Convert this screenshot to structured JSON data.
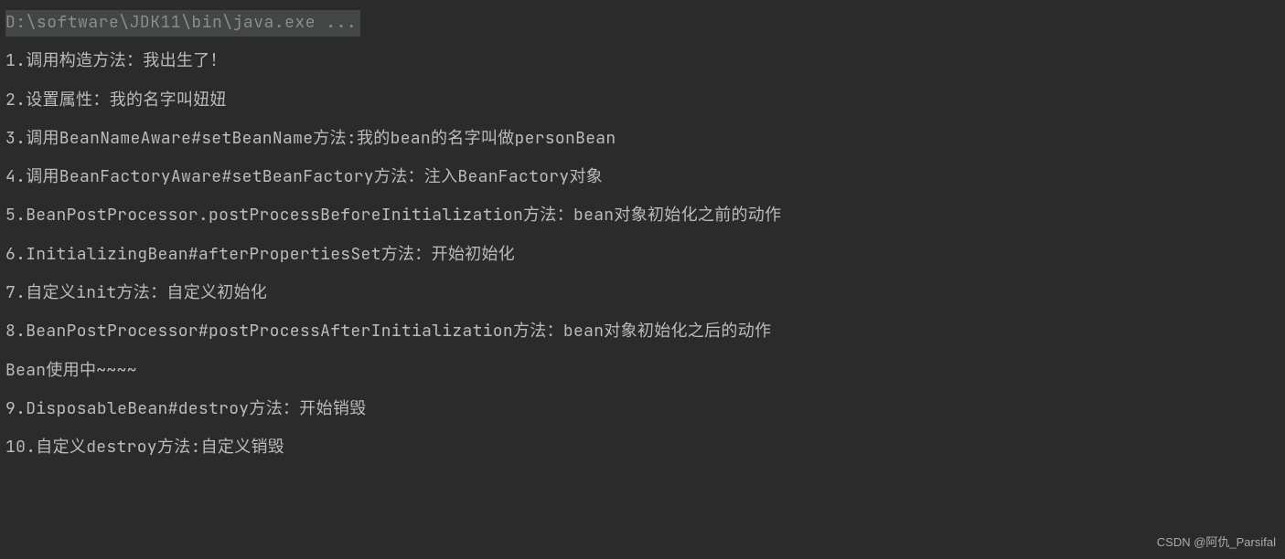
{
  "console": {
    "command": "D:\\software\\JDK11\\bin\\java.exe ...",
    "lines": [
      "1.调用构造方法：我出生了！",
      "2.设置属性：我的名字叫妞妞",
      "3.调用BeanNameAware#setBeanName方法:我的bean的名字叫做personBean",
      "4.调用BeanFactoryAware#setBeanFactory方法：注入BeanFactory对象",
      "5.BeanPostProcessor.postProcessBeforeInitialization方法：bean对象初始化之前的动作",
      "6.InitializingBean#afterPropertiesSet方法：开始初始化",
      "7.自定义init方法：自定义初始化",
      "8.BeanPostProcessor#postProcessAfterInitialization方法：bean对象初始化之后的动作",
      "Bean使用中~~~~",
      "9.DisposableBean#destroy方法：开始销毁",
      "10.自定义destroy方法:自定义销毁"
    ]
  },
  "watermark": "CSDN @阿仇_Parsifal"
}
